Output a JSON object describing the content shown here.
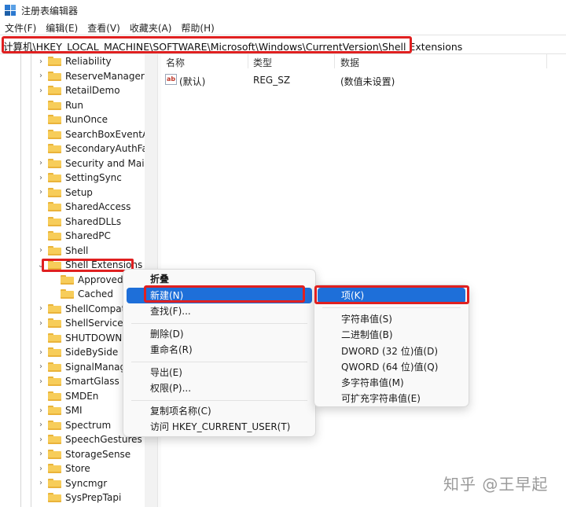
{
  "window": {
    "title": "注册表编辑器"
  },
  "menubar": [
    "文件(F)",
    "编辑(E)",
    "查看(V)",
    "收藏夹(A)",
    "帮助(H)"
  ],
  "address": "计算机\\HKEY_LOCAL_MACHINE\\SOFTWARE\\Microsoft\\Windows\\CurrentVersion\\Shell Extensions",
  "tree": {
    "items": [
      {
        "label": "Reliability",
        "expanded": false
      },
      {
        "label": "ReserveManager",
        "expanded": false
      },
      {
        "label": "RetailDemo",
        "expanded": false
      },
      {
        "label": "Run",
        "expanded": null
      },
      {
        "label": "RunOnce",
        "expanded": null
      },
      {
        "label": "SearchBoxEventArg",
        "expanded": null
      },
      {
        "label": "SecondaryAuthFacto",
        "expanded": null
      },
      {
        "label": "Security and Mainte",
        "expanded": false
      },
      {
        "label": "SettingSync",
        "expanded": false
      },
      {
        "label": "Setup",
        "expanded": false
      },
      {
        "label": "SharedAccess",
        "expanded": null
      },
      {
        "label": "SharedDLLs",
        "expanded": null
      },
      {
        "label": "SharedPC",
        "expanded": null
      },
      {
        "label": "Shell",
        "expanded": false
      },
      {
        "label": "Shell Extensions",
        "expanded": true,
        "selected": true
      },
      {
        "label": "Approved",
        "child": true
      },
      {
        "label": "Cached",
        "child": true
      },
      {
        "label": "ShellCompatib",
        "expanded": false
      },
      {
        "label": "ShellServiceOb",
        "expanded": false
      },
      {
        "label": "SHUTDOWN",
        "expanded": null
      },
      {
        "label": "SideBySide",
        "expanded": false
      },
      {
        "label": "SignalManage",
        "expanded": false
      },
      {
        "label": "SmartGlass",
        "expanded": false
      },
      {
        "label": "SMDEn",
        "expanded": null
      },
      {
        "label": "SMI",
        "expanded": false
      },
      {
        "label": "Spectrum",
        "expanded": false
      },
      {
        "label": "SpeechGestures",
        "expanded": false
      },
      {
        "label": "StorageSense",
        "expanded": false
      },
      {
        "label": "Store",
        "expanded": false
      },
      {
        "label": "Syncmgr",
        "expanded": false
      },
      {
        "label": "SysPrepTapi",
        "expanded": null
      }
    ]
  },
  "values": {
    "columns": [
      "名称",
      "类型",
      "数据"
    ],
    "rows": [
      {
        "name": "(默认)",
        "type": "REG_SZ",
        "data": "(数值未设置)",
        "icon": "ab-string-icon"
      }
    ]
  },
  "context_menu": {
    "items": [
      {
        "label": "折叠",
        "bold": true
      },
      {
        "label": "新建(N)",
        "active": true
      },
      {
        "label": "查找(F)..."
      },
      {
        "sep": true
      },
      {
        "label": "删除(D)"
      },
      {
        "label": "重命名(R)"
      },
      {
        "sep": true
      },
      {
        "label": "导出(E)"
      },
      {
        "label": "权限(P)..."
      },
      {
        "sep": true
      },
      {
        "label": "复制项名称(C)"
      },
      {
        "label": "访问 HKEY_CURRENT_USER(T)"
      }
    ]
  },
  "submenu": {
    "items": [
      {
        "label": "项(K)",
        "active": true
      },
      {
        "sep": true
      },
      {
        "label": "字符串值(S)"
      },
      {
        "label": "二进制值(B)"
      },
      {
        "label": "DWORD (32 位)值(D)"
      },
      {
        "label": "QWORD (64 位)值(Q)"
      },
      {
        "label": "多字符串值(M)"
      },
      {
        "label": "可扩充字符串值(E)"
      }
    ]
  },
  "watermark": "知乎 @王早起",
  "colors": {
    "highlight": "#e02020",
    "accent": "#1e6fd9",
    "folder": "#f7cd5a"
  }
}
